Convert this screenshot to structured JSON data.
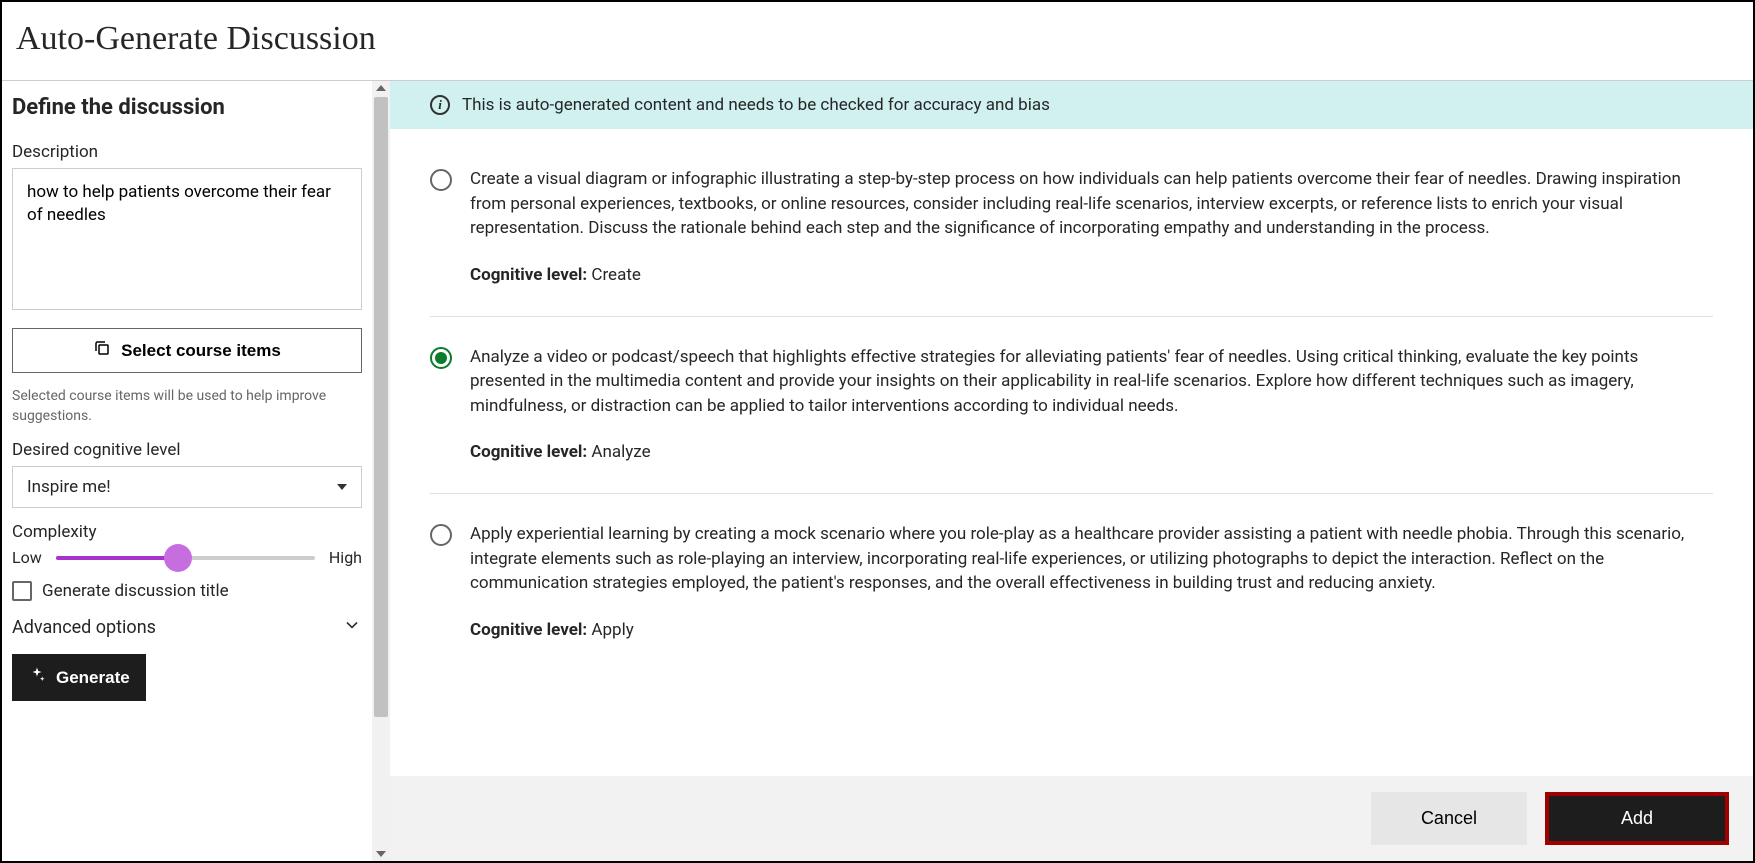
{
  "header": {
    "title": "Auto-Generate Discussion"
  },
  "left": {
    "define_heading": "Define the discussion",
    "description_label": "Description",
    "description_value": "how to help patients overcome their fear of needles",
    "select_items_label": "Select course items",
    "helper_text": "Selected course items will be used to help improve suggestions.",
    "cognitive_label": "Desired cognitive level",
    "cognitive_value": "Inspire me!",
    "complexity_label": "Complexity",
    "complexity_low": "Low",
    "complexity_high": "High",
    "generate_title_label": "Generate discussion title",
    "advanced_label": "Advanced options",
    "generate_button": "Generate"
  },
  "banner": {
    "text": "This is auto-generated content and needs to be checked for accuracy and bias"
  },
  "cognitive_level_prefix": "Cognitive level: ",
  "options": [
    {
      "selected": false,
      "text": "Create a visual diagram or infographic illustrating a step-by-step process on how individuals can help patients overcome their fear of needles. Drawing inspiration from personal experiences, textbooks, or online resources, consider including real-life scenarios, interview excerpts, or reference lists to enrich your visual representation. Discuss the rationale behind each step and the significance of incorporating empathy and understanding in the process.",
      "level": "Create"
    },
    {
      "selected": true,
      "text": "Analyze a video or podcast/speech that highlights effective strategies for alleviating patients' fear of needles. Using critical thinking, evaluate the key points presented in the multimedia content and provide your insights on their applicability in real-life scenarios. Explore how different techniques such as imagery, mindfulness, or distraction can be applied to tailor interventions according to individual needs.",
      "level": "Analyze"
    },
    {
      "selected": false,
      "text": "Apply experiential learning by creating a mock scenario where you role-play as a healthcare provider assisting a patient with needle phobia. Through this scenario, integrate elements such as role-playing an interview, incorporating real-life experiences, or utilizing photographs to depict the interaction. Reflect on the communication strategies employed, the patient's responses, and the overall effectiveness in building trust and reducing anxiety.",
      "level": "Apply"
    }
  ],
  "footer": {
    "cancel": "Cancel",
    "add": "Add"
  }
}
